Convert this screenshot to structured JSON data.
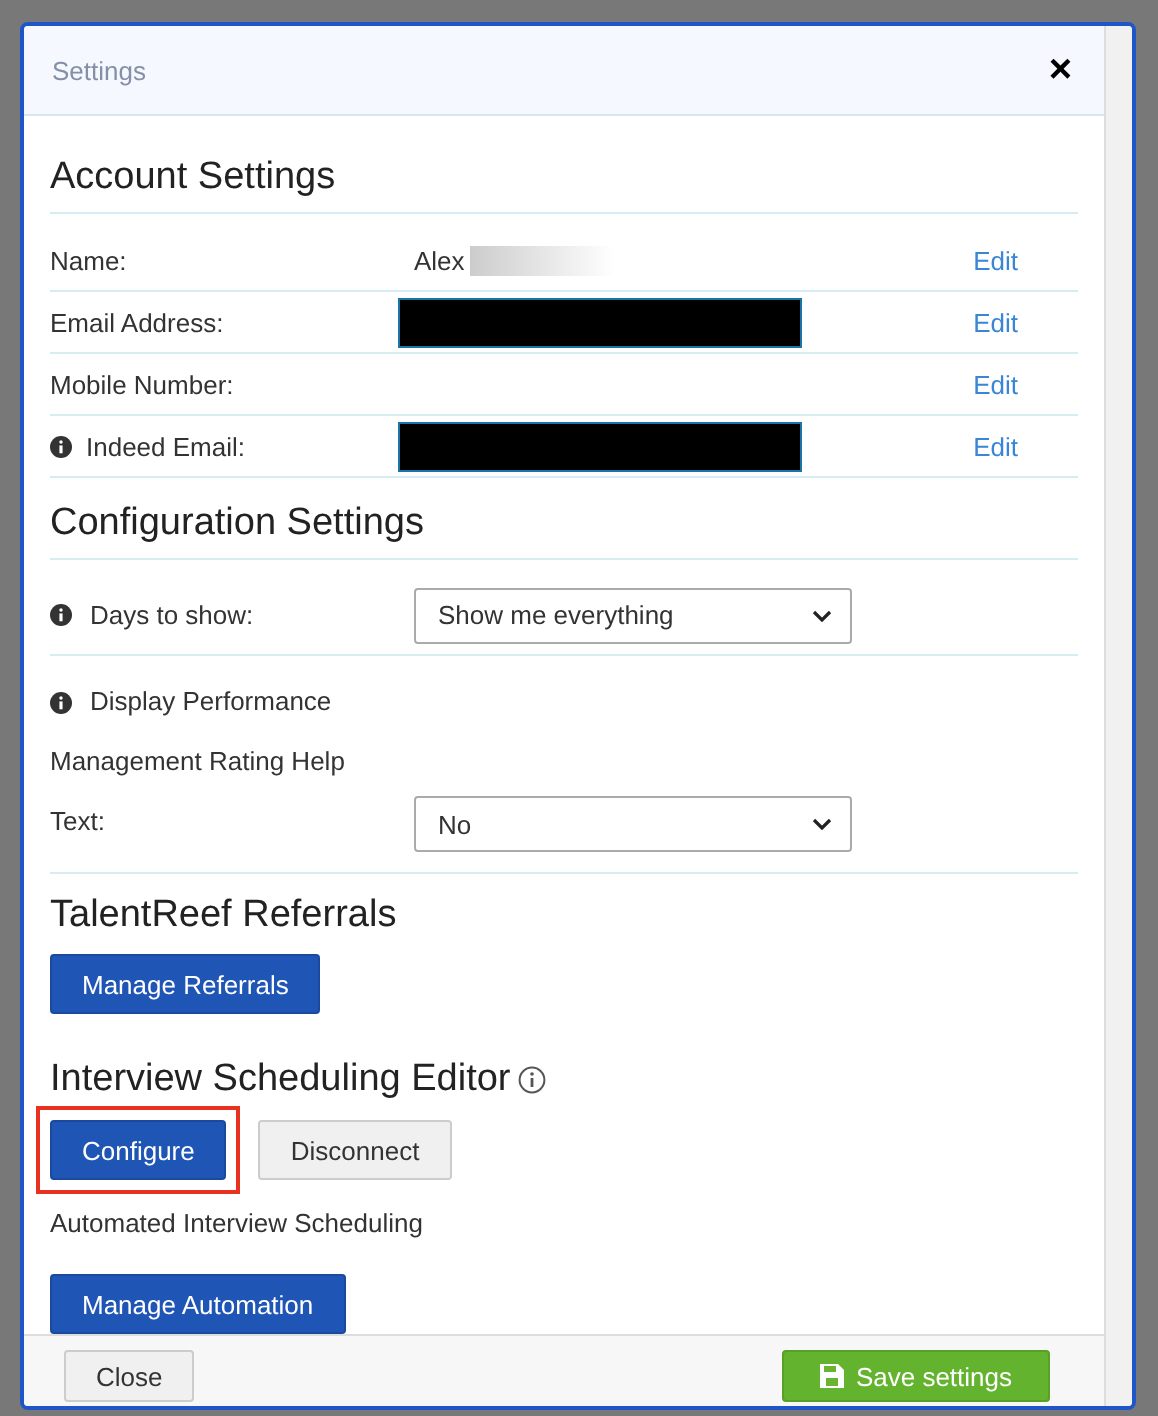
{
  "window": {
    "title": "Settings",
    "close": "×"
  },
  "account": {
    "heading": "Account Settings",
    "rows": [
      {
        "label": "Name:",
        "info": false,
        "kind": "text",
        "value": "Alex",
        "blurred": true,
        "action": "Edit"
      },
      {
        "label": "Email Address:",
        "info": false,
        "kind": "redacted",
        "action": "Edit"
      },
      {
        "label": "Mobile Number:",
        "info": false,
        "kind": "blank",
        "action": "Edit"
      },
      {
        "label": "Indeed Email:",
        "info": true,
        "kind": "redacted",
        "action": "Edit"
      }
    ]
  },
  "configuration": {
    "heading": "Configuration Settings",
    "rows": [
      {
        "label_lines": [
          "Days to show:"
        ],
        "info": true,
        "select": "Show me everything"
      },
      {
        "label_lines": [
          "Display Performance",
          "Management Rating Help",
          "Text:"
        ],
        "info": true,
        "select": "No"
      }
    ]
  },
  "referrals": {
    "heading": "TalentReef Referrals",
    "button": "Manage Referrals"
  },
  "interview": {
    "heading": "Interview Scheduling Editor",
    "info": true,
    "buttons": [
      {
        "label": "Configure",
        "kind": "primary",
        "highlighted": true
      },
      {
        "label": "Disconnect",
        "kind": "secondary",
        "highlighted": false
      }
    ],
    "note": "Automated Interview Scheduling",
    "button": "Manage Automation"
  },
  "footer": {
    "buttons": [
      {
        "label": "Close",
        "kind": "secondary"
      },
      {
        "label": "Save settings",
        "kind": "success"
      }
    ]
  }
}
